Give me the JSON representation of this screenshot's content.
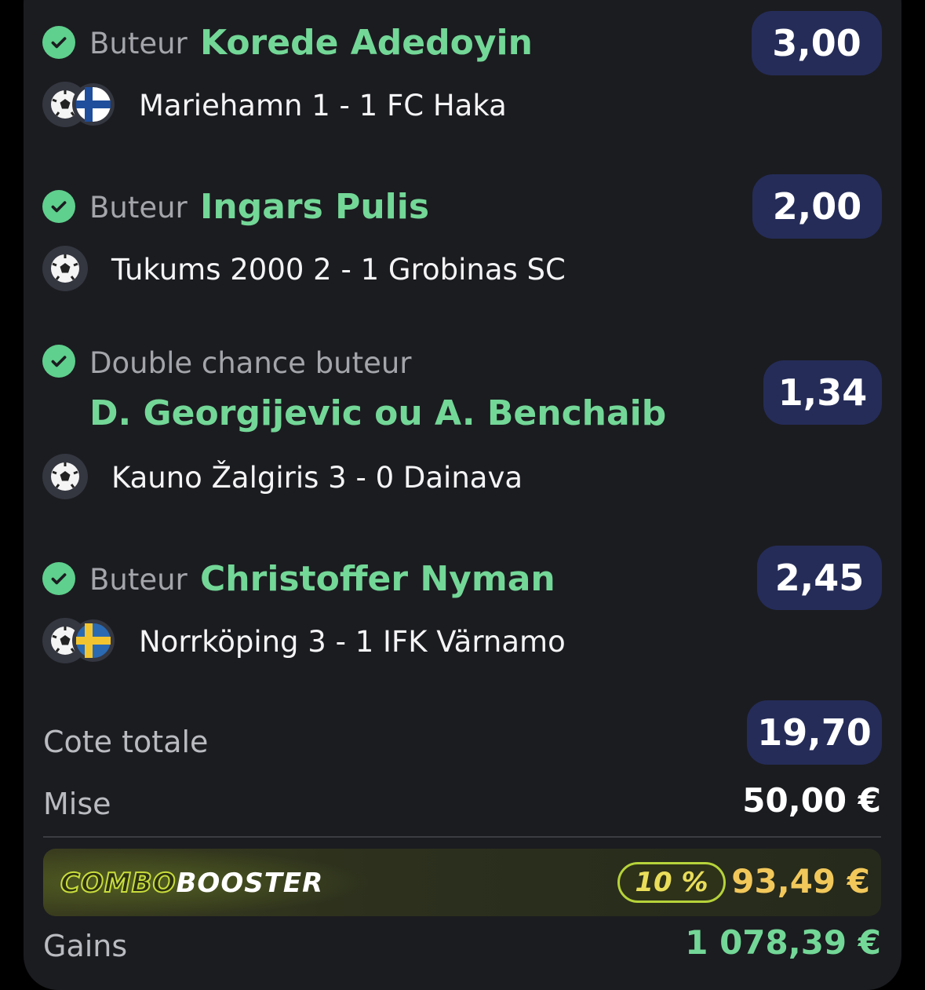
{
  "bets": [
    {
      "market": "Buteur",
      "selection": "Korede Adedoyin",
      "odds": "3,00",
      "match": "Mariehamn 1 - 1 FC Haka",
      "sport_icon": "soccer-ball-icon",
      "flag": "finland-flag"
    },
    {
      "market": "Buteur",
      "selection": "Ingars Pulis",
      "odds": "2,00",
      "match": "Tukums 2000 2 - 1 Grobinas SC",
      "sport_icon": "soccer-ball-icon"
    },
    {
      "market": "Double chance buteur",
      "selection": "D. Georgijevic ou A. Benchaib",
      "odds": "1,34",
      "match": "Kauno Žalgiris 3 - 0 Dainava",
      "sport_icon": "soccer-ball-icon"
    },
    {
      "market": "Buteur",
      "selection": "Christoffer Nyman",
      "odds": "2,45",
      "match": "Norrköping 3 - 1 IFK Värnamo",
      "sport_icon": "soccer-ball-icon",
      "flag": "sweden-flag"
    }
  ],
  "summary": {
    "total_odds_label": "Cote totale",
    "total_odds_value": "19,70",
    "stake_label": "Mise",
    "stake_value": "50,00 €",
    "gains_label": "Gains",
    "gains_value": "1 078,39 €"
  },
  "booster": {
    "logo_part1": "COMBO",
    "logo_part2": "BOOSTER",
    "percent": "10 %",
    "amount": "93,49 €"
  },
  "colors": {
    "background": "#1b1c20",
    "selection_green": "#73d797",
    "check_green": "#5fd08d",
    "odds_pill": "#252c58",
    "booster_amount": "#f2c85b",
    "gains_green": "#73d797"
  }
}
